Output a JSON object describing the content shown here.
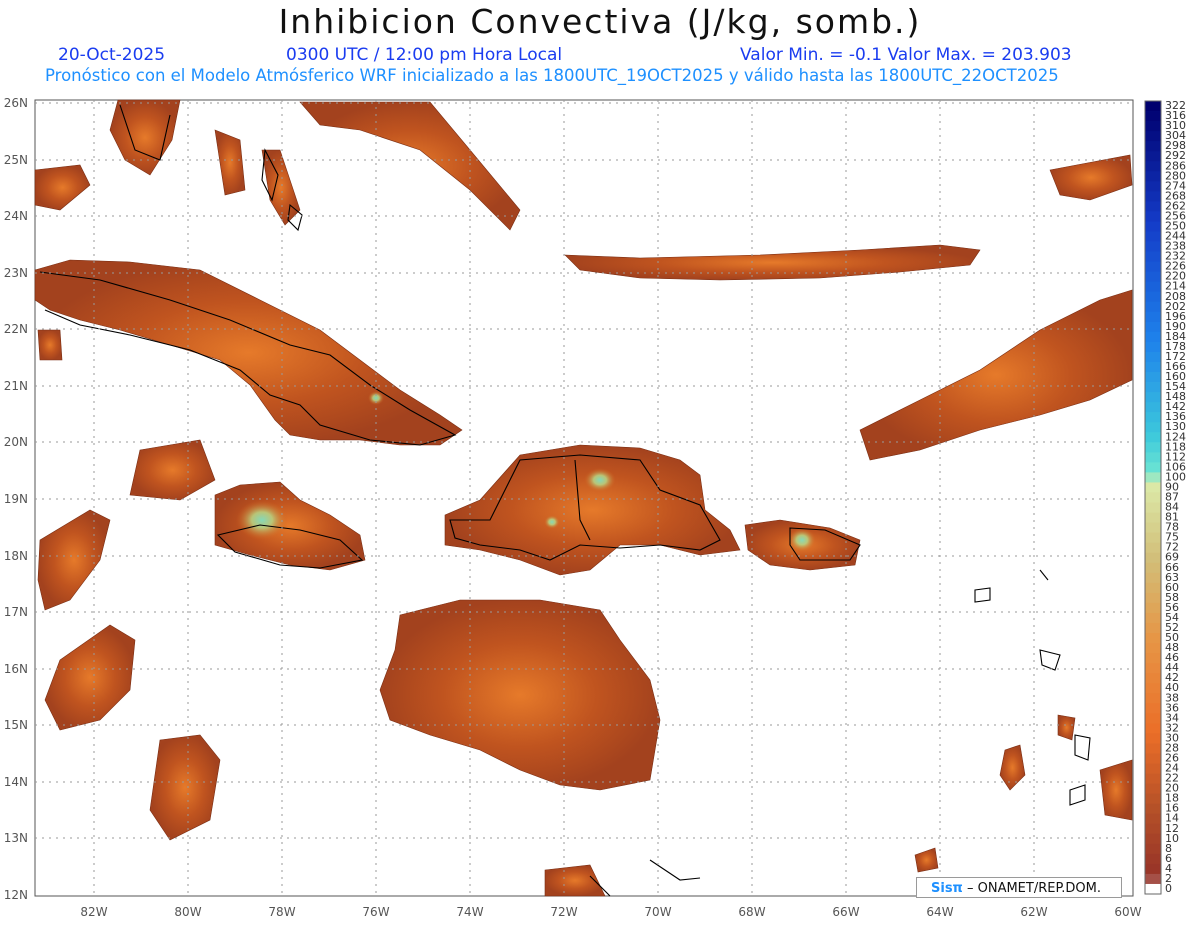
{
  "title": "Inhibicion Convectiva (J/kg, somb.)",
  "header": {
    "date": "20-Oct-2025",
    "time": "0300 UTC / 12:00 pm Hora Local",
    "value_range": "Valor Min. = -0.1  Valor Max. = 203.903",
    "subtitle": "Pronóstico con el Modelo Atmósferico WRF inicializado a las 1800UTC_19OCT2025 y válido hasta las  1800UTC_22OCT2025"
  },
  "map": {
    "lat_labels": [
      "26N",
      "25N",
      "24N",
      "23N",
      "22N",
      "21N",
      "20N",
      "19N",
      "18N",
      "17N",
      "16N",
      "15N",
      "14N",
      "13N",
      "12N"
    ],
    "lon_labels": [
      "82W",
      "80W",
      "78W",
      "76W",
      "74W",
      "72W",
      "70W",
      "68W",
      "66W",
      "64W",
      "62W",
      "60W"
    ],
    "colors": {
      "low": "#a0421f",
      "mid": "#d2601c",
      "high": "#f08a2a",
      "peak": "#7ee6c8"
    }
  },
  "colorbar": {
    "labels": [
      "322",
      "316",
      "310",
      "304",
      "298",
      "292",
      "286",
      "280",
      "274",
      "268",
      "262",
      "256",
      "250",
      "244",
      "238",
      "232",
      "226",
      "220",
      "214",
      "208",
      "202",
      "196",
      "190",
      "184",
      "178",
      "172",
      "166",
      "160",
      "154",
      "148",
      "142",
      "136",
      "130",
      "124",
      "118",
      "112",
      "106",
      "100",
      "90",
      "87",
      "84",
      "81",
      "78",
      "75",
      "72",
      "69",
      "66",
      "63",
      "60",
      "58",
      "56",
      "54",
      "52",
      "50",
      "48",
      "46",
      "44",
      "42",
      "40",
      "38",
      "36",
      "34",
      "32",
      "30",
      "28",
      "26",
      "24",
      "22",
      "20",
      "18",
      "16",
      "14",
      "12",
      "10",
      "8",
      "6",
      "4",
      "2",
      "0"
    ]
  },
  "credit": {
    "logo": "Sisπ",
    "agency": "– ONAMET/REP.DOM."
  }
}
